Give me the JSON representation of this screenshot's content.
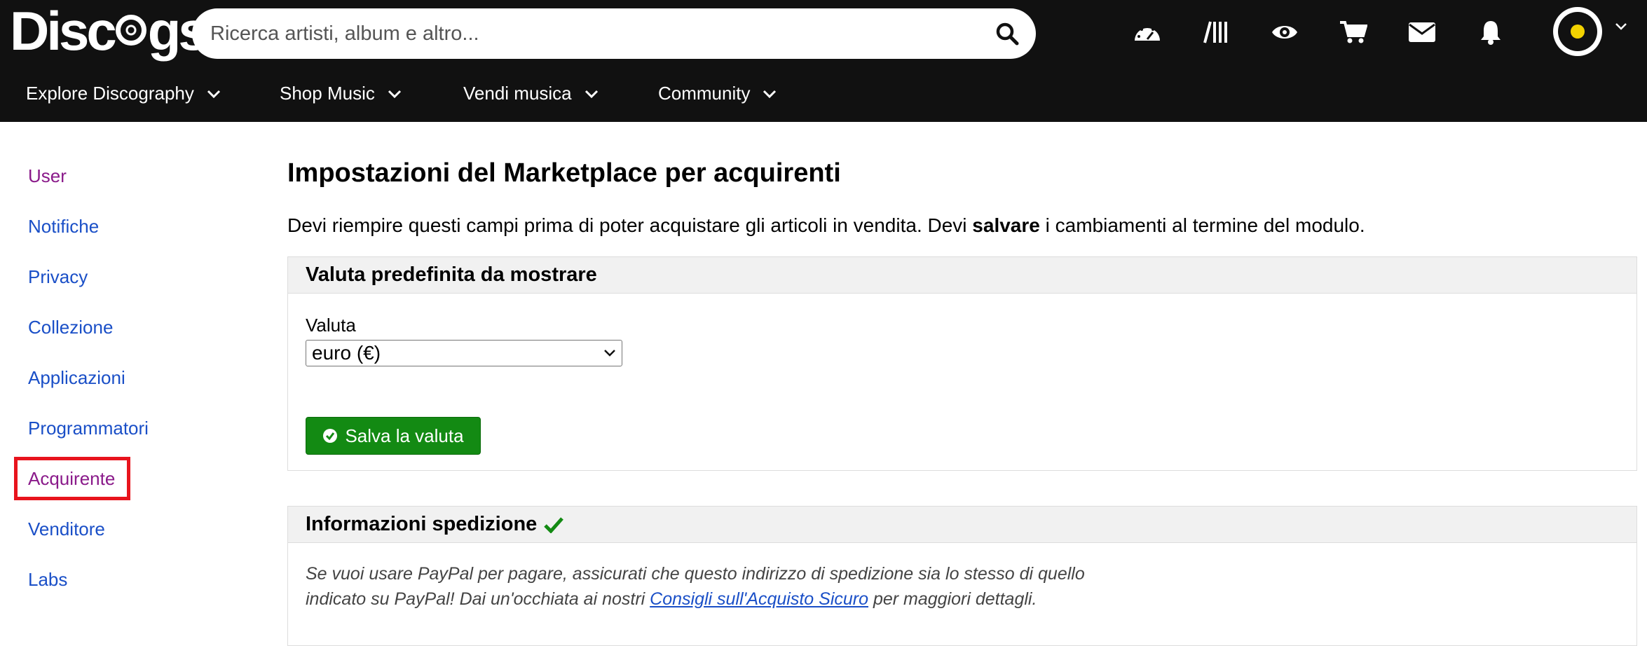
{
  "header": {
    "logo_text": "Discogs",
    "search": {
      "placeholder": "Ricerca artisti, album e altro...",
      "value": ""
    },
    "icons": [
      "dashboard-icon",
      "collection-icon",
      "wantlist-eye-icon",
      "cart-icon",
      "mail-icon",
      "bell-icon"
    ],
    "avatar": "user-avatar"
  },
  "nav": {
    "items": [
      {
        "label": "Explore Discography"
      },
      {
        "label": "Shop Music"
      },
      {
        "label": "Vendi musica"
      },
      {
        "label": "Community"
      }
    ]
  },
  "sidebar": {
    "items": [
      {
        "label": "User",
        "visited": true
      },
      {
        "label": "Notifiche",
        "visited": false
      },
      {
        "label": "Privacy",
        "visited": false
      },
      {
        "label": "Collezione",
        "visited": false
      },
      {
        "label": "Applicazioni",
        "visited": false
      },
      {
        "label": "Programmatori",
        "visited": false
      },
      {
        "label": "Acquirente",
        "visited": true,
        "highlighted": true
      },
      {
        "label": "Venditore",
        "visited": false
      },
      {
        "label": "Labs",
        "visited": false
      }
    ]
  },
  "main": {
    "title": "Impostazioni del Marketplace per acquirenti",
    "intro_before": "Devi riempire questi campi prima di poter acquistare gli articoli in vendita. Devi ",
    "intro_bold": "salvare",
    "intro_after": " i cambiamenti al termine del modulo.",
    "currency_panel": {
      "heading": "Valuta predefinita da mostrare",
      "field_label": "Valuta",
      "selected": "euro (€)",
      "save_label": "Salva la valuta"
    },
    "shipping_panel": {
      "heading": "Informazioni spedizione",
      "note_line1": "Se vuoi usare PayPal per pagare, assicurati che questo indirizzo di spedizione sia lo stesso di quello",
      "note_line2_before": "indicato su PayPal! Dai un'occhiata ai nostri ",
      "note_link": "Consigli sull'Acquisto Sicuro",
      "note_line2_after": " per maggiori dettagli."
    }
  },
  "colors": {
    "header_bg": "#111111",
    "link": "#1a4fc7",
    "visited_link": "#8a1a8a",
    "save_button": "#138a13",
    "highlight": "#e8141d"
  }
}
